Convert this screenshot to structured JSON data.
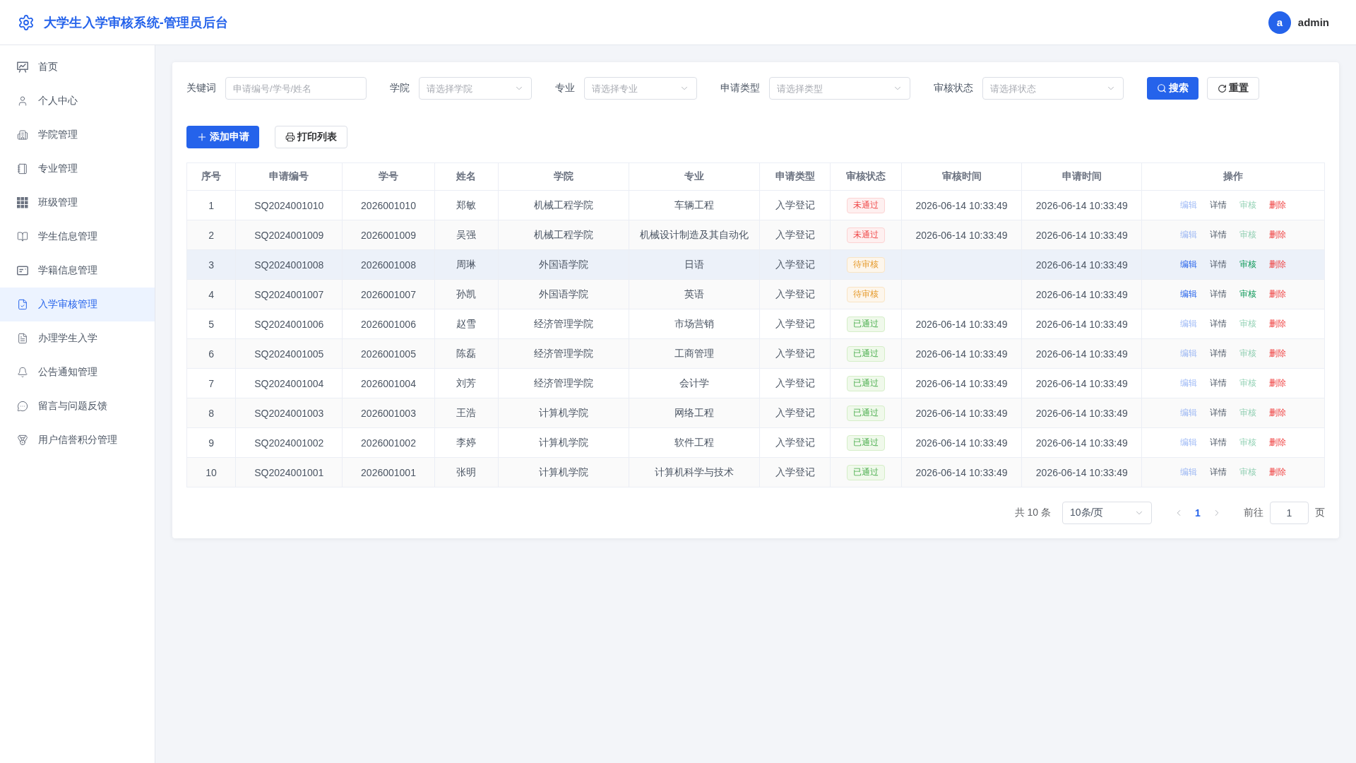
{
  "header": {
    "title": "大学生入学审核系统-管理员后台",
    "user": {
      "avatar": "a",
      "name": "admin"
    }
  },
  "sidebar": {
    "items": [
      {
        "label": "首页",
        "selected": false
      },
      {
        "label": "个人中心",
        "selected": false
      },
      {
        "label": "学院管理",
        "selected": false
      },
      {
        "label": "专业管理",
        "selected": false
      },
      {
        "label": "班级管理",
        "selected": false
      },
      {
        "label": "学生信息管理",
        "selected": false
      },
      {
        "label": "学籍信息管理",
        "selected": false
      },
      {
        "label": "入学审核管理",
        "selected": true
      },
      {
        "label": "办理学生入学",
        "selected": false
      },
      {
        "label": "公告通知管理",
        "selected": false
      },
      {
        "label": "留言与问题反馈",
        "selected": false
      },
      {
        "label": "用户信誉积分管理",
        "selected": false
      }
    ]
  },
  "filters": {
    "fields": [
      {
        "label": "关键词",
        "kind": "input",
        "placeholder": "申请编号/学号/姓名"
      },
      {
        "label": "学院",
        "kind": "select",
        "placeholder": "请选择学院"
      },
      {
        "label": "专业",
        "kind": "select",
        "placeholder": "请选择专业"
      },
      {
        "label": "申请类型",
        "kind": "select",
        "placeholder": "请选择类型"
      },
      {
        "label": "审核状态",
        "kind": "select",
        "placeholder": "请选择状态"
      }
    ],
    "search_button": "搜索",
    "reset_button": "重置"
  },
  "toolbar": {
    "add_button": "添加申请",
    "print_button": "打印列表"
  },
  "table": {
    "columns": [
      "序号",
      "申请编号",
      "学号",
      "姓名",
      "学院",
      "专业",
      "申请类型",
      "审核状态",
      "审核时间",
      "申请时间",
      "操作"
    ],
    "rows": [
      {
        "index": "1",
        "application_no": "SQ2024001010",
        "student_no": "2026001010",
        "name": "郑敏",
        "college": "机械工程学院",
        "major": "车辆工程",
        "type": "入学登记",
        "status": {
          "label": "未通过",
          "kind": "rejected"
        },
        "review_time": "2026-06-14 10:33:49",
        "apply_time": "2026-06-14 10:33:49",
        "highlighted": false,
        "actions": [
          {
            "label": "编辑",
            "kind": "edit",
            "disabled": true
          },
          {
            "label": "详情",
            "kind": "details",
            "disabled": false
          },
          {
            "label": "审核",
            "kind": "review",
            "disabled": true
          },
          {
            "label": "删除",
            "kind": "delete",
            "disabled": false
          }
        ]
      },
      {
        "index": "2",
        "application_no": "SQ2024001009",
        "student_no": "2026001009",
        "name": "吴强",
        "college": "机械工程学院",
        "major": "机械设计制造及其自动化",
        "type": "入学登记",
        "status": {
          "label": "未通过",
          "kind": "rejected"
        },
        "review_time": "2026-06-14 10:33:49",
        "apply_time": "2026-06-14 10:33:49",
        "highlighted": false,
        "actions": [
          {
            "label": "编辑",
            "kind": "edit",
            "disabled": true
          },
          {
            "label": "详情",
            "kind": "details",
            "disabled": false
          },
          {
            "label": "审核",
            "kind": "review",
            "disabled": true
          },
          {
            "label": "删除",
            "kind": "delete",
            "disabled": false
          }
        ]
      },
      {
        "index": "3",
        "application_no": "SQ2024001008",
        "student_no": "2026001008",
        "name": "周琳",
        "college": "外国语学院",
        "major": "日语",
        "type": "入学登记",
        "status": {
          "label": "待审核",
          "kind": "pending"
        },
        "apply_time": "2026-06-14 10:33:49",
        "highlighted": true,
        "actions": [
          {
            "label": "编辑",
            "kind": "edit",
            "disabled": false
          },
          {
            "label": "详情",
            "kind": "details",
            "disabled": false
          },
          {
            "label": "审核",
            "kind": "review",
            "disabled": false
          },
          {
            "label": "删除",
            "kind": "delete",
            "disabled": false
          }
        ]
      },
      {
        "index": "4",
        "application_no": "SQ2024001007",
        "student_no": "2026001007",
        "name": "孙凯",
        "college": "外国语学院",
        "major": "英语",
        "type": "入学登记",
        "status": {
          "label": "待审核",
          "kind": "pending"
        },
        "apply_time": "2026-06-14 10:33:49",
        "highlighted": false,
        "actions": [
          {
            "label": "编辑",
            "kind": "edit",
            "disabled": false
          },
          {
            "label": "详情",
            "kind": "details",
            "disabled": false
          },
          {
            "label": "审核",
            "kind": "review",
            "disabled": false
          },
          {
            "label": "删除",
            "kind": "delete",
            "disabled": false
          }
        ]
      },
      {
        "index": "5",
        "application_no": "SQ2024001006",
        "student_no": "2026001006",
        "name": "赵雪",
        "college": "经济管理学院",
        "major": "市场营销",
        "type": "入学登记",
        "status": {
          "label": "已通过",
          "kind": "approved"
        },
        "review_time": "2026-06-14 10:33:49",
        "apply_time": "2026-06-14 10:33:49",
        "highlighted": false,
        "actions": [
          {
            "label": "编辑",
            "kind": "edit",
            "disabled": true
          },
          {
            "label": "详情",
            "kind": "details",
            "disabled": false
          },
          {
            "label": "审核",
            "kind": "review",
            "disabled": true
          },
          {
            "label": "删除",
            "kind": "delete",
            "disabled": false
          }
        ]
      },
      {
        "index": "6",
        "application_no": "SQ2024001005",
        "student_no": "2026001005",
        "name": "陈磊",
        "college": "经济管理学院",
        "major": "工商管理",
        "type": "入学登记",
        "status": {
          "label": "已通过",
          "kind": "approved"
        },
        "review_time": "2026-06-14 10:33:49",
        "apply_time": "2026-06-14 10:33:49",
        "highlighted": false,
        "actions": [
          {
            "label": "编辑",
            "kind": "edit",
            "disabled": true
          },
          {
            "label": "详情",
            "kind": "details",
            "disabled": false
          },
          {
            "label": "审核",
            "kind": "review",
            "disabled": true
          },
          {
            "label": "删除",
            "kind": "delete",
            "disabled": false
          }
        ]
      },
      {
        "index": "7",
        "application_no": "SQ2024001004",
        "student_no": "2026001004",
        "name": "刘芳",
        "college": "经济管理学院",
        "major": "会计学",
        "type": "入学登记",
        "status": {
          "label": "已通过",
          "kind": "approved"
        },
        "review_time": "2026-06-14 10:33:49",
        "apply_time": "2026-06-14 10:33:49",
        "highlighted": false,
        "actions": [
          {
            "label": "编辑",
            "kind": "edit",
            "disabled": true
          },
          {
            "label": "详情",
            "kind": "details",
            "disabled": false
          },
          {
            "label": "审核",
            "kind": "review",
            "disabled": true
          },
          {
            "label": "删除",
            "kind": "delete",
            "disabled": false
          }
        ]
      },
      {
        "index": "8",
        "application_no": "SQ2024001003",
        "student_no": "2026001003",
        "name": "王浩",
        "college": "计算机学院",
        "major": "网络工程",
        "type": "入学登记",
        "status": {
          "label": "已通过",
          "kind": "approved"
        },
        "review_time": "2026-06-14 10:33:49",
        "apply_time": "2026-06-14 10:33:49",
        "highlighted": false,
        "actions": [
          {
            "label": "编辑",
            "kind": "edit",
            "disabled": true
          },
          {
            "label": "详情",
            "kind": "details",
            "disabled": false
          },
          {
            "label": "审核",
            "kind": "review",
            "disabled": true
          },
          {
            "label": "删除",
            "kind": "delete",
            "disabled": false
          }
        ]
      },
      {
        "index": "9",
        "application_no": "SQ2024001002",
        "student_no": "2026001002",
        "name": "李婷",
        "college": "计算机学院",
        "major": "软件工程",
        "type": "入学登记",
        "status": {
          "label": "已通过",
          "kind": "approved"
        },
        "review_time": "2026-06-14 10:33:49",
        "apply_time": "2026-06-14 10:33:49",
        "highlighted": false,
        "actions": [
          {
            "label": "编辑",
            "kind": "edit",
            "disabled": true
          },
          {
            "label": "详情",
            "kind": "details",
            "disabled": false
          },
          {
            "label": "审核",
            "kind": "review",
            "disabled": true
          },
          {
            "label": "删除",
            "kind": "delete",
            "disabled": false
          }
        ]
      },
      {
        "index": "10",
        "application_no": "SQ2024001001",
        "student_no": "2026001001",
        "name": "张明",
        "college": "计算机学院",
        "major": "计算机科学与技术",
        "type": "入学登记",
        "status": {
          "label": "已通过",
          "kind": "approved"
        },
        "review_time": "2026-06-14 10:33:49",
        "apply_time": "2026-06-14 10:33:49",
        "highlighted": false,
        "actions": [
          {
            "label": "编辑",
            "kind": "edit",
            "disabled": true
          },
          {
            "label": "详情",
            "kind": "details",
            "disabled": false
          },
          {
            "label": "审核",
            "kind": "review",
            "disabled": true
          },
          {
            "label": "删除",
            "kind": "delete",
            "disabled": false
          }
        ]
      }
    ]
  },
  "pagination": {
    "total": "共 10 条",
    "page_size": "10条/页",
    "pages": [
      {
        "label": "1",
        "selected": true
      }
    ],
    "goto_label": "前往",
    "goto_value": "1",
    "goto_suffix": "页"
  }
}
